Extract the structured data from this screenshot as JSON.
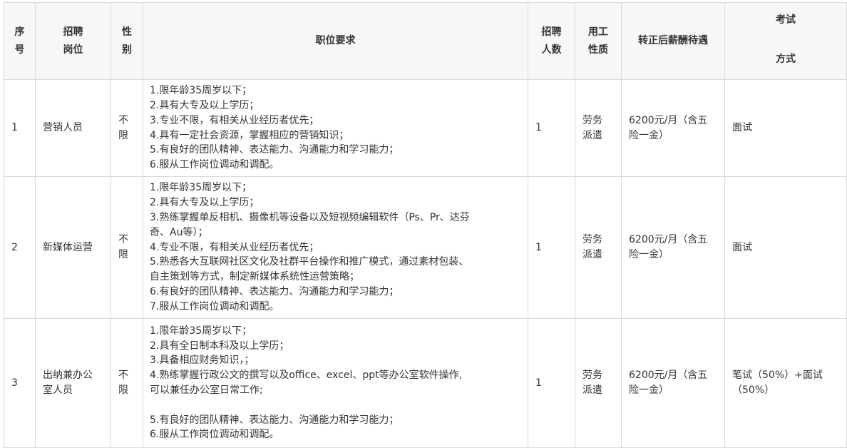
{
  "headers": {
    "index": [
      "序",
      "号"
    ],
    "position": [
      "招聘",
      "岗位"
    ],
    "gender": [
      "性",
      "别"
    ],
    "requirements": "职位要求",
    "count": [
      "招聘",
      "人数"
    ],
    "employment_type": [
      "用工",
      "性质"
    ],
    "salary": "转正后薪酬待遇",
    "exam": [
      "考试",
      "方式"
    ]
  },
  "rows": [
    {
      "index": "1",
      "position": "营销人员",
      "gender": [
        "不",
        "限"
      ],
      "requirements": [
        "1.限年龄35周岁以下；",
        "2.具有大专及以上学历；",
        "3.专业不限，有相关从业经历者优先；",
        "4.具有一定社会资源，掌握相应的营销知识；",
        "5.有良好的团队精神、表达能力、沟通能力和学习能力；",
        "6.服从工作岗位调动和调配。"
      ],
      "count": "1",
      "employment_type": [
        "劳务",
        "派遣"
      ],
      "salary": [
        "6200元/月（含五",
        "险一金）"
      ],
      "exam": "面试"
    },
    {
      "index": "2",
      "position": "新媒体运营",
      "gender": [
        "不",
        "限"
      ],
      "requirements": [
        "1.限年龄35周岁以下；",
        "2.具有大专及以上学历；",
        "3.熟练掌握单反相机、摄像机等设备以及短视频编辑软件（Ps、Pr、达芬",
        "奇、Au等）；",
        "4.专业不限，有相关从业经历者优先；",
        "5.熟悉各大互联网社区文化及社群平台操作和推广模式，通过素材包装、",
        "自主策划等方式，制定新媒体系统性运营策略；",
        "6.有良好的团队精神、表达能力、沟通能力和学习能力；",
        "7.服从工作岗位调动和调配。"
      ],
      "count": "1",
      "employment_type": [
        "劳务",
        "派遣"
      ],
      "salary": [
        "6200元/月（含五",
        "险一金）"
      ],
      "exam": "面试"
    },
    {
      "index": "3",
      "position": [
        "出纳兼办公",
        "室人员"
      ],
      "gender": [
        "不",
        "限"
      ],
      "requirements": [
        "1.限年龄35周岁以下；",
        "2.具有全日制本科及以上学历；",
        "3.具备相应财务知识，；",
        "4.熟练掌握行政公文的撰写以及office、excel、ppt等办公室软件操作,",
        "可以兼任办公室日常工作;",
        "",
        "5.有良好的团队精神、表达能力、沟通能力和学习能力；",
        "6.服从工作岗位调动和调配。"
      ],
      "count": "1",
      "employment_type": [
        "劳务",
        "派遣"
      ],
      "salary": [
        "6200元/月（含五",
        "险一金）"
      ],
      "exam": [
        "笔试（50%）+面试",
        "（50%）"
      ]
    }
  ]
}
